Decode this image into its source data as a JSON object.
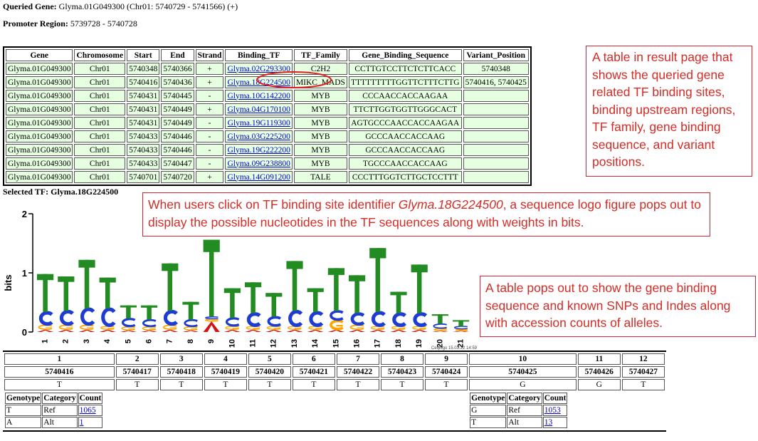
{
  "header": {
    "queried_gene_label": "Queried Gene:",
    "queried_gene_value": "Glyma.01G049300 (Chr01: 5740729 - 5741566) (+)",
    "promoter_label": "Promoter Region:",
    "promoter_value": "5739728 - 5740728",
    "selected_tf_label": "Selected TF:",
    "selected_tf_value": "Glyma.18G224500"
  },
  "tf_table": {
    "columns": [
      "Gene",
      "Chromosome",
      "Start",
      "End",
      "Strand",
      "Binding_TF",
      "TF_Family",
      "Gene_Binding_Sequence",
      "Variant_Position"
    ],
    "rows": [
      [
        "Glyma.01G049300",
        "Chr01",
        "5740348",
        "5740366",
        "+",
        "Glyma.02G293300",
        "C2H2",
        "CCTTGTCCTTCTCTTCACC",
        "5740348"
      ],
      [
        "Glyma.01G049300",
        "Chr01",
        "5740416",
        "5740436",
        "+",
        "Glyma.18G224500",
        "MIKC_MADS",
        "TTTTTTTTTGGTTCTTTCTTG",
        "5740416, 5740425"
      ],
      [
        "Glyma.01G049300",
        "Chr01",
        "5740431",
        "5740445",
        "-",
        "Glyma.10G142200",
        "MYB",
        "CCCAACCACCAAGAA",
        ""
      ],
      [
        "Glyma.01G049300",
        "Chr01",
        "5740431",
        "5740449",
        "+",
        "Glyma.04G170100",
        "MYB",
        "TTCTTGGTGGTTGGGCACT",
        ""
      ],
      [
        "Glyma.01G049300",
        "Chr01",
        "5740431",
        "5740449",
        "-",
        "Glyma.19G119300",
        "MYB",
        "AGTGCCCAACCACCAAGAA",
        ""
      ],
      [
        "Glyma.01G049300",
        "Chr01",
        "5740433",
        "5740446",
        "-",
        "Glyma.03G225200",
        "MYB",
        "GCCCAACCACCAAG",
        ""
      ],
      [
        "Glyma.01G049300",
        "Chr01",
        "5740433",
        "5740446",
        "-",
        "Glyma.19G222200",
        "MYB",
        "GCCCAACCACCAAG",
        ""
      ],
      [
        "Glyma.01G049300",
        "Chr01",
        "5740433",
        "5740447",
        "-",
        "Glyma.09G238800",
        "MYB",
        "TGCCCAACCACCAAG",
        ""
      ],
      [
        "Glyma.01G049300",
        "Chr01",
        "5740701",
        "5740720",
        "+",
        "Glyma.14G091200",
        "TALE",
        "CCCTTTGGTCTTGCTCCTTT",
        ""
      ]
    ],
    "highlight_color": "#e5ffe0",
    "circle_color": "#e02020"
  },
  "annotations": {
    "note1": "A table in result page that shows the queried gene related TF binding sites, binding upstream regions, TF family, gene binding sequence, and  variant positions.",
    "note2_prefix": "When users click on TF binding site identifier ",
    "note2_tf": "Glyma.18G224500",
    "note2_suffix": ", a sequence logo figure pops out to display the possible nucleotides in the TF sequences along with weights in bits.",
    "note3": "A table pops out to show the gene binding sequence and known SNPs and Indes along with accession counts of alleles.",
    "border_color": "#dd2222"
  },
  "logo": {
    "ylabel": "bits",
    "y_ticks": [
      "0",
      "1",
      "2"
    ],
    "ylim": [
      0,
      2
    ],
    "x_ticks": [
      "1",
      "2",
      "3",
      "4",
      "5",
      "6",
      "7",
      "8",
      "9",
      "10",
      "11",
      "12",
      "13",
      "14",
      "15",
      "16",
      "17",
      "18",
      "19",
      "20",
      "21"
    ],
    "watermark": "Ceqlogo 15.03.22 14:59",
    "colors": {
      "T": "#228b22",
      "C": "#1e3cd2",
      "G": "#ffa500",
      "A": "#d21414"
    },
    "positions": [
      {
        "T": 0.64,
        "C": 0.22,
        "G": 0.08,
        "A": 0.04
      },
      {
        "T": 0.58,
        "C": 0.24,
        "G": 0.08,
        "A": 0.04
      },
      {
        "T": 0.82,
        "C": 0.28,
        "G": 0.08,
        "A": 0.04
      },
      {
        "T": 0.52,
        "C": 0.3,
        "G": 0.06,
        "A": 0.04
      },
      {
        "T": 0.22,
        "C": 0.14,
        "G": 0.06,
        "A": 0.03
      },
      {
        "T": 0.24,
        "C": 0.12,
        "G": 0.06,
        "A": 0.03
      },
      {
        "T": 0.8,
        "C": 0.24,
        "G": 0.08,
        "A": 0.04
      },
      {
        "T": 0.3,
        "C": 0.12,
        "G": 0.06,
        "A": 0.03
      },
      {
        "T": 1.3,
        "C": 0.04,
        "G": 0.04,
        "A": 0.18
      },
      {
        "T": 0.5,
        "C": 0.14,
        "G": 0.06,
        "A": 0.04
      },
      {
        "T": 0.52,
        "C": 0.22,
        "G": 0.06,
        "A": 0.04
      },
      {
        "T": 0.4,
        "C": 0.16,
        "G": 0.06,
        "A": 0.04
      },
      {
        "T": 0.84,
        "C": 0.26,
        "G": 0.06,
        "A": 0.04
      },
      {
        "T": 0.4,
        "C": 0.24,
        "G": 0.06,
        "A": 0.04
      },
      {
        "T": 0.72,
        "C": 0.16,
        "G": 0.16,
        "A": 0.04
      },
      {
        "T": 0.64,
        "C": 0.2,
        "G": 0.08,
        "A": 0.04
      },
      {
        "T": 1.08,
        "C": 0.24,
        "G": 0.06,
        "A": 0.04
      },
      {
        "T": 0.36,
        "C": 0.22,
        "G": 0.06,
        "A": 0.04
      },
      {
        "T": 0.82,
        "C": 0.22,
        "G": 0.06,
        "A": 0.04
      },
      {
        "T": 0.16,
        "C": 0.08,
        "G": 0.04,
        "A": 0.02
      },
      {
        "T": 0.1,
        "C": 0.05,
        "G": 0.03,
        "A": 0.02
      }
    ]
  },
  "snp_table": {
    "indices": [
      "1",
      "2",
      "3",
      "4",
      "5",
      "6",
      "7",
      "8",
      "9",
      "10",
      "11",
      "12"
    ],
    "positions": [
      "5740416",
      "5740417",
      "5740418",
      "5740419",
      "5740420",
      "5740421",
      "5740422",
      "5740423",
      "5740424",
      "5740425",
      "5740426",
      "5740427"
    ],
    "bases": [
      "T",
      "T",
      "T",
      "T",
      "T",
      "T",
      "T",
      "T",
      "T",
      "G",
      "G",
      "T"
    ],
    "allele_headers": [
      "Genotype",
      "Category",
      "Count"
    ],
    "alleles_col1": [
      [
        "T",
        "Ref",
        "1065"
      ],
      [
        "A",
        "Alt",
        "1"
      ]
    ],
    "alleles_col10": [
      [
        "G",
        "Ref",
        "1053"
      ],
      [
        "T",
        "Alt",
        "13"
      ]
    ]
  }
}
